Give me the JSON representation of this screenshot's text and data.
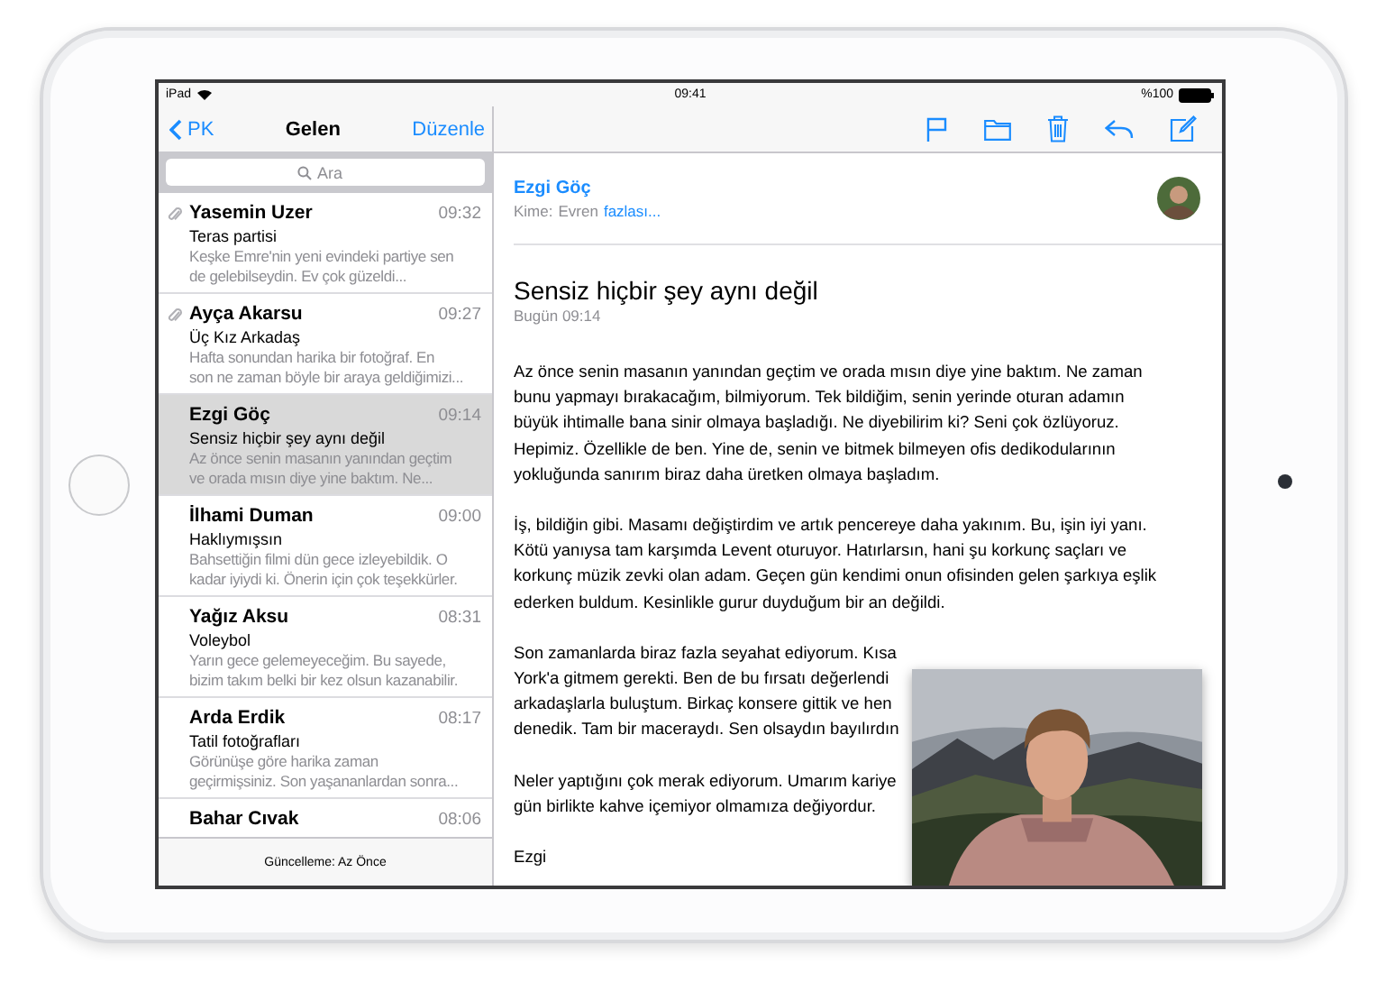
{
  "status_bar": {
    "device": "iPad",
    "time": "09:41",
    "battery": "%100"
  },
  "mailbox": {
    "back": "PK",
    "title": "Gelen",
    "edit": "Düzenle",
    "search": {
      "placeholder": "Ara"
    },
    "messages": [
      {
        "sender": "Yasemin Uzer",
        "time": "09:32",
        "subject": "Teras partisi",
        "preview": [
          "Keşke Emre'nin yeni evindeki partiye sen",
          "de gelebilseydin. Ev çok güzeldi..."
        ],
        "attachment": true,
        "selected": false
      },
      {
        "sender": "Ayça Akarsu",
        "time": "09:27",
        "subject": "Üç Kız Arkadaş",
        "preview": [
          "Hafta sonundan harika bir fotoğraf. En",
          "son ne zaman böyle bir araya geldiğimizi..."
        ],
        "attachment": true,
        "selected": false
      },
      {
        "sender": "Ezgi Göç",
        "time": "09:14",
        "subject": "Sensiz hiçbir şey aynı değil",
        "preview": [
          "Az önce senin masanın yanından geçtim",
          "ve orada mısın diye yine baktım. Ne..."
        ],
        "attachment": false,
        "selected": true
      },
      {
        "sender": "İlhami Duman",
        "time": "09:00",
        "subject": "Haklıymışsın",
        "preview": [
          "Bahsettiğin filmi dün gece izleyebildik. O",
          "kadar iyiydi ki. Önerin için çok teşekkürler."
        ],
        "attachment": false,
        "selected": false
      },
      {
        "sender": "Yağız Aksu",
        "time": "08:31",
        "subject": "Voleybol",
        "preview": [
          "Yarın gece gelemeyeceğim. Bu sayede,",
          "bizim takım belki bir kez olsun kazanabilir."
        ],
        "attachment": false,
        "selected": false
      },
      {
        "sender": "Arda Erdik",
        "time": "08:17",
        "subject": "Tatil fotoğrafları",
        "preview": [
          "Görünüşe göre harika zaman",
          "geçirmişsiniz. Son yaşananlardan sonra..."
        ],
        "attachment": false,
        "selected": false
      },
      {
        "sender": "Bahar Cıvak",
        "time": "08:06",
        "attachment": false,
        "selected": false
      }
    ],
    "footer": "Güncelleme: Az Önce"
  },
  "message": {
    "sender": "Ezgi Göç",
    "to_label": "Kime:",
    "to": "Evren",
    "more": "fazlası...",
    "subject": "Sensiz hiçbir şey aynı değil",
    "date": "Bugün 09:14",
    "paragraphs": [
      [
        "Az önce senin masanın yanından geçtim ve orada mısın diye yine baktım. Ne zaman",
        "bunu yapmayı bırakacağım, bilmiyorum. Tek bildiğim, senin yerinde oturan adamın",
        "büyük ihtimalle bana sinir olmaya başladığı. Ne diyebilirim ki? Seni çok özlüyoruz.",
        "Hepimiz. Özellikle de ben. Yine de, senin ve bitmek bilmeyen ofis dedikodularının",
        "yokluğunda sanırım biraz daha üretken olmaya başladım."
      ],
      [
        "İş, bildiğin gibi. Masamı değiştirdim ve artık pencereye daha yakınım. Bu, işin iyi yanı.",
        "Kötü yanıysa tam karşımda Levent oturuyor. Hatırlarsın, hani şu korkunç saçları ve",
        "korkunç müzik zevki olan adam. Geçen gün kendimi onun ofisinden gelen şarkıya eşlik",
        "ederken buldum. Kesinlikle gurur duyduğum bir an değildi."
      ],
      [
        "Son zamanlarda biraz fazla seyahat ediyorum. Kısa",
        "York'a gitmem gerekti. Ben de bu fırsatı değerlendi",
        "arkadaşlarla buluştum. Birkaç konsere gittik ve hen",
        "denedik. Tam bir maceraydı. Sen olsaydın bayılırdın"
      ],
      [
        "Neler yaptığını çok merak ediyorum. Umarım kariye",
        "gün birlikte kahve içemiyor olmamıza değiyordur."
      ]
    ],
    "signature": "Ezgi"
  }
}
